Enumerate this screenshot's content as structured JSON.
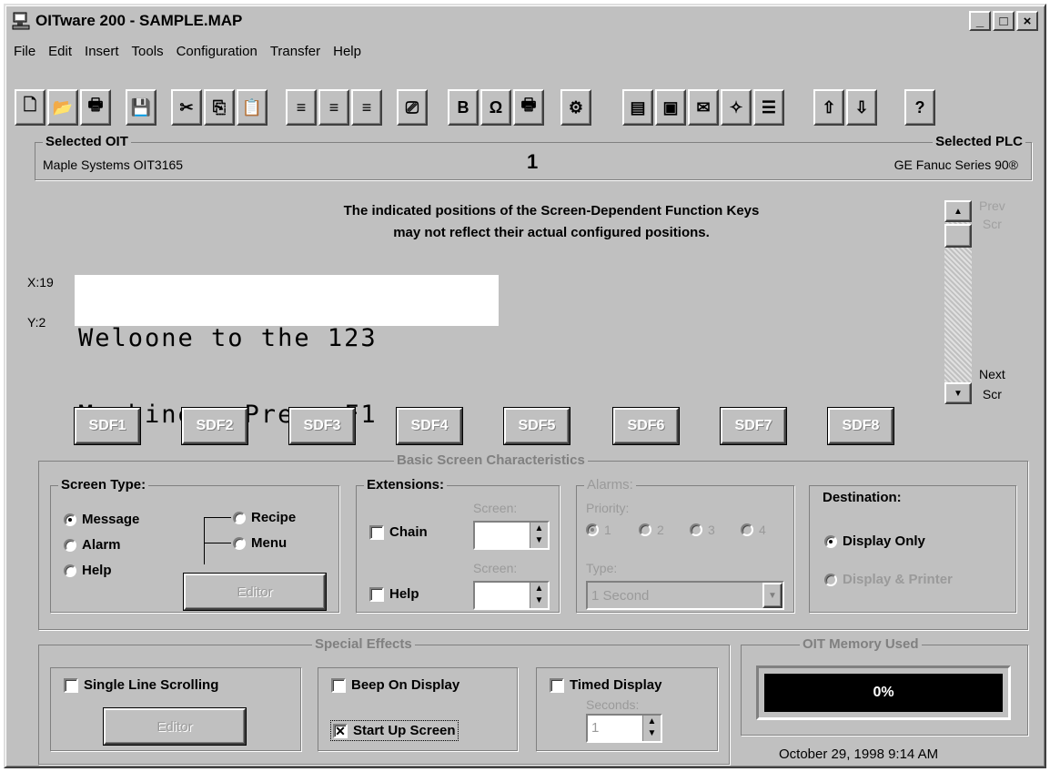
{
  "window": {
    "title": "OITware 200 - SAMPLE.MAP",
    "minimize": "_",
    "maximize": "□",
    "close": "×"
  },
  "menu": [
    "File",
    "Edit",
    "Insert",
    "Tools",
    "Configuration",
    "Transfer",
    "Help"
  ],
  "toolbar": {
    "icons": [
      "new-file-icon",
      "open-folder-icon",
      "print-icon",
      "save-icon",
      "cut-icon",
      "copy-icon",
      "paste-icon",
      "align-left-icon",
      "align-center-icon",
      "align-right-icon",
      "delete-icon",
      "bold-icon",
      "omega-icon",
      "printer-icon",
      "controller-icon",
      "oit-device-icon",
      "screen-icon",
      "message-icon",
      "star-icon",
      "list-icon",
      "upload-icon",
      "download-icon",
      "help-icon"
    ],
    "glyphs": [
      "🗋",
      "📂",
      "🖶",
      "💾",
      "✂",
      "⎘",
      "📋",
      "≡",
      "≡",
      "≡",
      "⎚",
      "B",
      "Ω",
      "🖶",
      "⚙",
      "▤",
      "▣",
      "✉",
      "✧",
      "☰",
      "⇧",
      "⇩",
      "?"
    ]
  },
  "selected": {
    "oit_label": "Selected OIT",
    "oit_value": "Maple Systems OIT3165",
    "screen_number": "1",
    "plc_label": "Selected PLC",
    "plc_value": "GE Fanuc Series 90®"
  },
  "notice": {
    "line1": "The indicated positions of the Screen-Dependent Function Keys",
    "line2": "may not reflect their actual configured positions."
  },
  "screen_nav": {
    "prev": "Prev",
    "prev_sub": "Scr",
    "next": "Next",
    "next_sub": "Scr"
  },
  "display": {
    "x_label": "X:19",
    "y_label": "Y:2",
    "line1": "Weloone to the 123",
    "line2": "Machine - Press F1"
  },
  "sdf_keys": [
    "SDF1",
    "SDF2",
    "SDF3",
    "SDF4",
    "SDF5",
    "SDF6",
    "SDF7",
    "SDF8"
  ],
  "basic": {
    "title": "Basic Screen Characteristics",
    "screen_type": {
      "label": "Screen Type:",
      "message": "Message",
      "alarm": "Alarm",
      "help": "Help",
      "recipe": "Recipe",
      "menu": "Menu",
      "editor": "Editor",
      "selected": "Message"
    },
    "extensions": {
      "label": "Extensions:",
      "chain": "Chain",
      "help": "Help",
      "screen_label": "Screen:"
    },
    "alarms": {
      "label": "Alarms:",
      "priority_label": "Priority:",
      "priorities": [
        "1",
        "2",
        "3",
        "4"
      ],
      "type_label": "Type:",
      "type_value": "1 Second"
    },
    "destination": {
      "label": "Destination:",
      "display_only": "Display Only",
      "display_printer": "Display & Printer"
    }
  },
  "special": {
    "title": "Special Effects",
    "single_line": "Single Line Scrolling",
    "editor": "Editor",
    "beep": "Beep On Display",
    "startup": "Start Up Screen",
    "startup_checked": true,
    "timed": "Timed Display",
    "seconds_label": "Seconds:",
    "seconds_value": "1"
  },
  "memory": {
    "title": "OIT Memory Used",
    "value": "0%"
  },
  "timestamp": "October 29, 1998  9:14 AM"
}
